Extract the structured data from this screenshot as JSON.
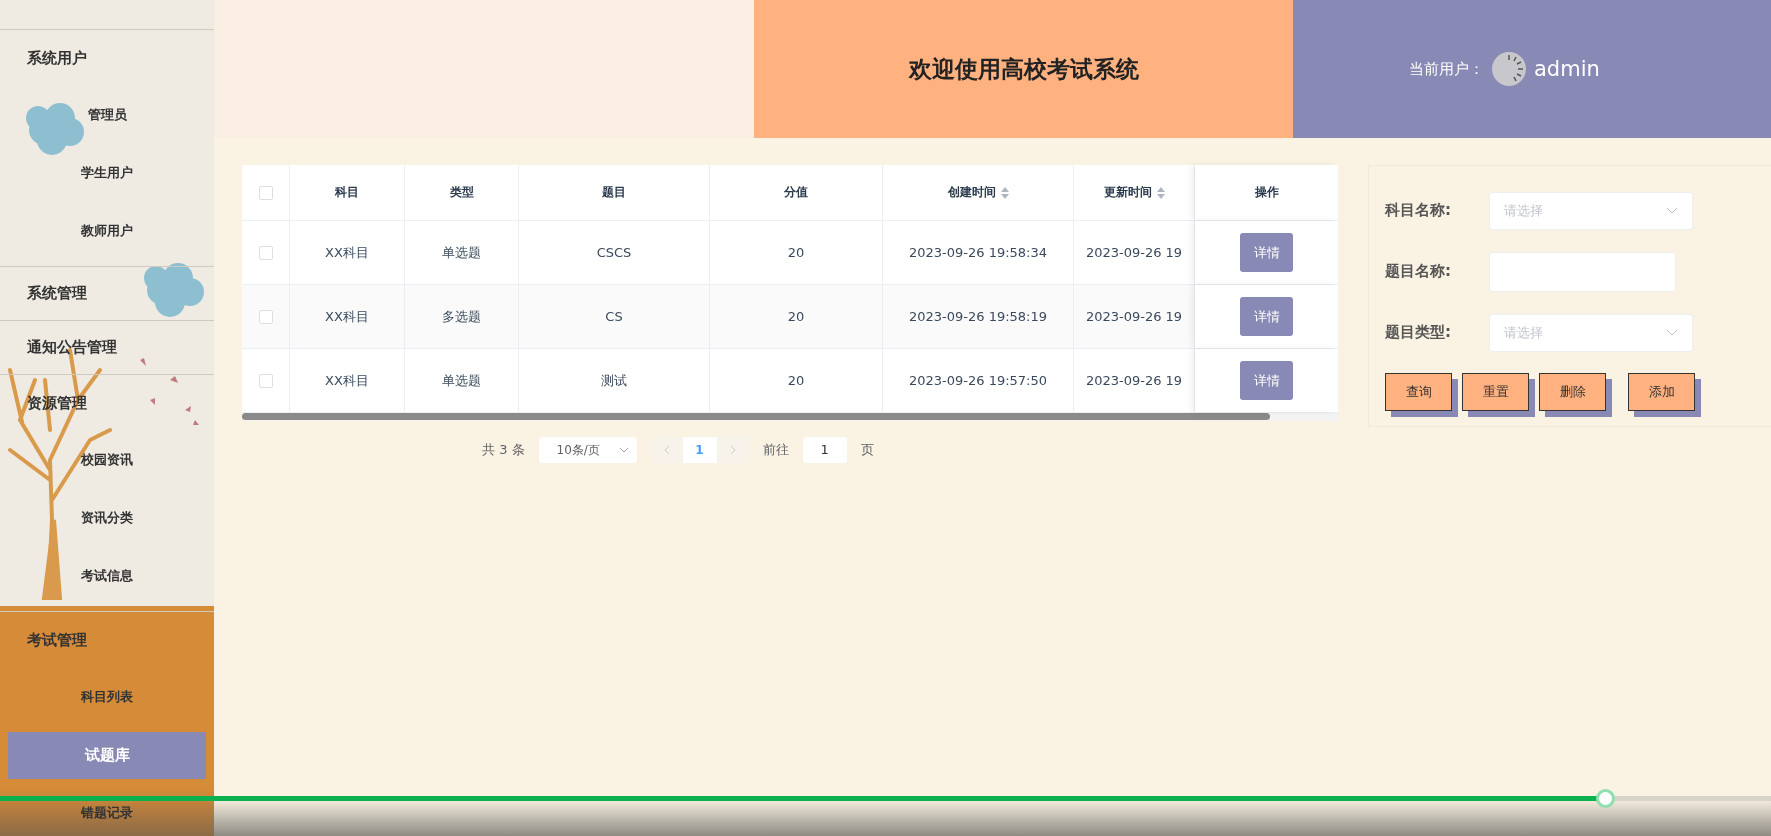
{
  "sidebar": {
    "groups": [
      {
        "label": "系统用户",
        "children": [
          {
            "label": "管理员",
            "selected": false
          },
          {
            "label": "学生用户",
            "selected": false
          },
          {
            "label": "教师用户",
            "selected": false
          }
        ]
      },
      {
        "label": "系统管理"
      },
      {
        "label": "通知公告管理"
      },
      {
        "label": "资源管理",
        "children": [
          {
            "label": "校园资讯",
            "selected": false
          },
          {
            "label": "资讯分类",
            "selected": false
          },
          {
            "label": "考试信息",
            "selected": false
          }
        ]
      },
      {
        "label": "考试管理",
        "children": [
          {
            "label": "科目列表",
            "selected": false
          },
          {
            "label": "试题库",
            "selected": true
          },
          {
            "label": "错题记录",
            "selected": false
          }
        ]
      }
    ]
  },
  "header": {
    "title": "欢迎使用高校考试系统",
    "user_label": "当前用户：",
    "user_name": "admin"
  },
  "table": {
    "header_checked": false,
    "columns": [
      {
        "label": "科目",
        "sortable": false
      },
      {
        "label": "类型",
        "sortable": false
      },
      {
        "label": "题目",
        "sortable": false
      },
      {
        "label": "分值",
        "sortable": false
      },
      {
        "label": "创建时间",
        "sortable": true
      },
      {
        "label": "更新时间",
        "sortable": true
      },
      {
        "label": "操作",
        "sortable": false
      }
    ],
    "rows": [
      {
        "checked": false,
        "cells": [
          "XX科目",
          "单选题",
          "CSCS",
          "20",
          "2023-09-26 19:58:34",
          "2023-09-26 19"
        ],
        "action": "详情"
      },
      {
        "checked": false,
        "cells": [
          "XX科目",
          "多选题",
          "CS",
          "20",
          "2023-09-26 19:58:19",
          "2023-09-26 19"
        ],
        "action": "详情"
      },
      {
        "checked": false,
        "cells": [
          "XX科目",
          "单选题",
          "测试",
          "20",
          "2023-09-26 19:57:50",
          "2023-09-26 19"
        ],
        "action": "详情"
      }
    ]
  },
  "pagination": {
    "total": "共 3 条",
    "page_size": "10条/页",
    "pages": [
      {
        "label": "1",
        "selected": true
      }
    ],
    "goto_label": "前往",
    "goto_value": "1",
    "goto_suffix": "页"
  },
  "filter": {
    "fields": [
      {
        "kind": "select",
        "label": "科目名称:",
        "placeholder": "请选择"
      },
      {
        "kind": "input",
        "label": "题目名称:"
      },
      {
        "kind": "select",
        "label": "题目类型:",
        "placeholder": "请选择"
      }
    ],
    "buttons": [
      "查询",
      "重置",
      "删除",
      "添加"
    ]
  },
  "video_player": {
    "level": 0.906
  }
}
